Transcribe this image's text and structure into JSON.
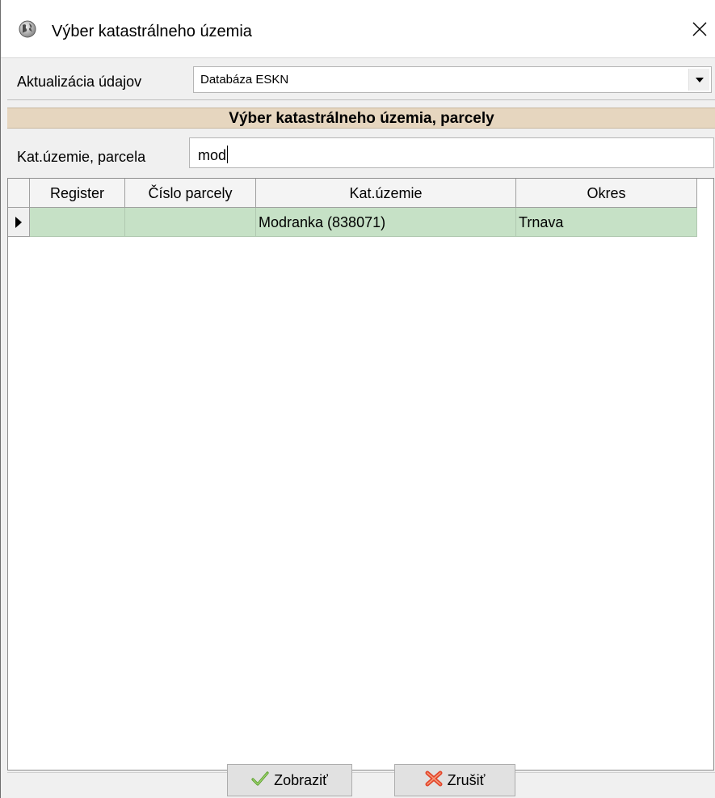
{
  "window": {
    "title": "Výber katastrálneho územia",
    "icon": "globe-icon",
    "close_icon": "close-icon"
  },
  "update": {
    "label": "Aktualizácia údajov",
    "selected": "Databáza ESKN",
    "arrow_icon": "chevron-down-icon"
  },
  "section": {
    "header": "Výber katastrálneho územia, parcely"
  },
  "search": {
    "label": "Kat.územie, parcela",
    "value": "mod"
  },
  "grid": {
    "columns": [
      "Register",
      "Číslo parcely",
      "Kat.územie",
      "Okres"
    ],
    "rows": [
      {
        "register": "",
        "parcel": "",
        "territory": "Modranka (838071)",
        "district": "Trnava",
        "selected": true
      }
    ],
    "row_color": "#c6e1c6"
  },
  "buttons": {
    "show_label": "Zobraziť",
    "show_icon": "checkmark-icon",
    "cancel_label": "Zrušiť",
    "cancel_icon": "red-x-icon"
  }
}
